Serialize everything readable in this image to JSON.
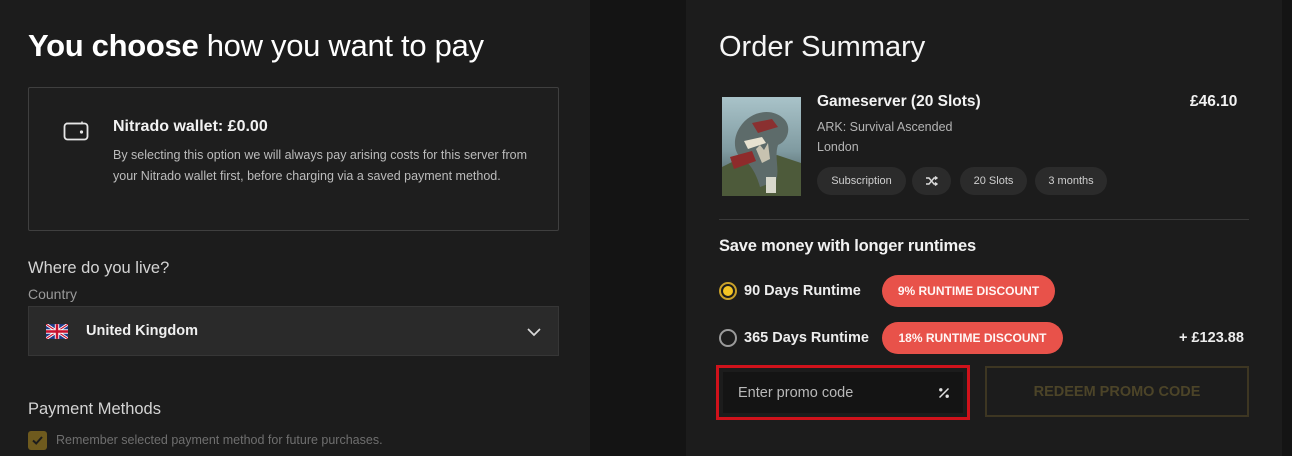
{
  "payment": {
    "title_strong": "You choose",
    "title_rest": "how you want to pay",
    "wallet": {
      "icon": "wallet-icon",
      "title": "Nitrado wallet: £0.00",
      "description": "By selecting this option we will always pay arising costs for this server from your Nitrado wallet first, before charging via a saved payment method."
    },
    "where_label": "Where do you live?",
    "country_label": "Country",
    "country_value": "United Kingdom",
    "payment_methods_label": "Payment Methods",
    "remember_label": "Remember selected payment method for future purchases."
  },
  "summary": {
    "title": "Order Summary",
    "item": {
      "name": "Gameserver (20 Slots)",
      "price": "£46.10",
      "game": "ARK: Survival Ascended",
      "location": "London",
      "chips": {
        "subscription": "Subscription",
        "slots": "20 Slots",
        "months": "3 months"
      }
    },
    "save_title": "Save money with longer runtimes",
    "runtimes": [
      {
        "label": "90 Days Runtime",
        "discount": "9% RUNTIME DISCOUNT",
        "selected": true,
        "extra": ""
      },
      {
        "label": "365 Days Runtime",
        "discount": "18% RUNTIME DISCOUNT",
        "selected": false,
        "extra": "+ £123.88"
      }
    ],
    "promo": {
      "placeholder": "Enter promo code",
      "redeem_label": "REDEEM PROMO CODE"
    }
  },
  "colors": {
    "accent_yellow": "#f3c424",
    "discount_red": "#e8524a",
    "highlight_red": "#d0121b",
    "panel_bg": "#1c1c1c"
  }
}
